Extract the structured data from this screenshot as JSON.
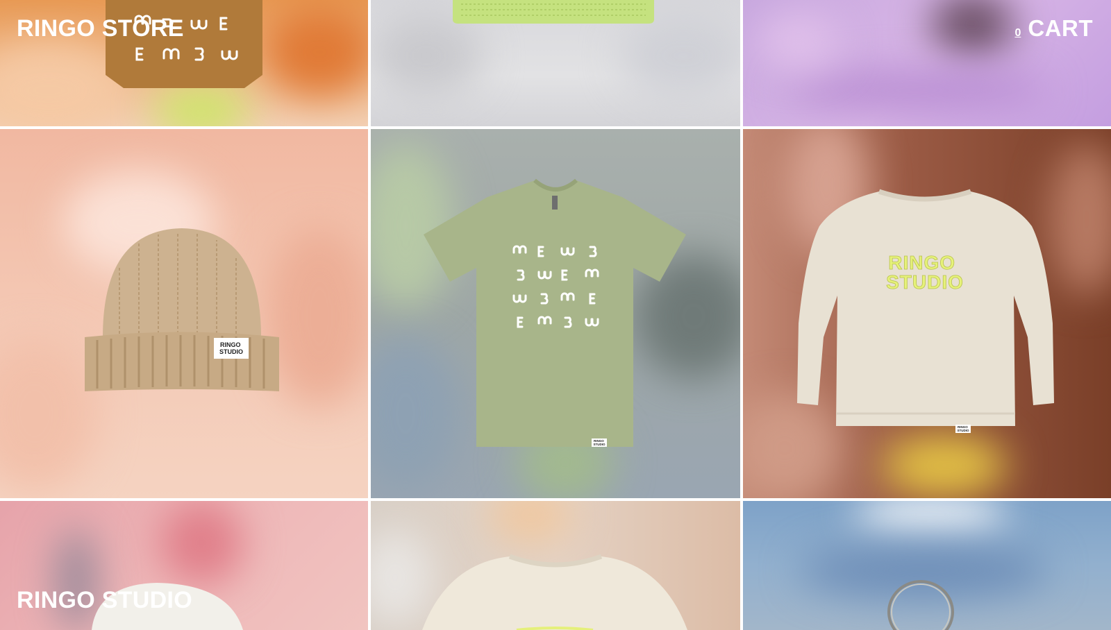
{
  "header": {
    "store_title": "RINGO STORE",
    "cart": {
      "count": "0",
      "label": "CART"
    }
  },
  "footer": {
    "studio_title": "RINGO STUDIO"
  },
  "products": [
    {
      "name": "tote-bag",
      "icon": "tote-bag-image"
    },
    {
      "name": "green-beanie",
      "icon": "beanie-image"
    },
    {
      "name": "lilac-item",
      "icon": "blurred-image"
    },
    {
      "name": "tan-beanie",
      "icon": "beanie-image",
      "label_text": [
        "RINGO",
        "STUDIO"
      ]
    },
    {
      "name": "sage-tshirt",
      "icon": "tshirt-image",
      "label_text": [
        "RINGO",
        "STUDIO"
      ]
    },
    {
      "name": "cream-sweatshirt",
      "icon": "sweatshirt-image",
      "print_text": [
        "RINGO",
        "STUDIO"
      ],
      "label_text": [
        "RINGO",
        "STUDIO"
      ]
    },
    {
      "name": "white-cap",
      "icon": "cap-image"
    },
    {
      "name": "cream-sweatshirt-2",
      "icon": "sweatshirt-image"
    },
    {
      "name": "keyring",
      "icon": "keyring-image"
    }
  ],
  "colors": {
    "accent_lime": "#d6ef6a",
    "sweatshirt_print": "#e6f27a"
  }
}
